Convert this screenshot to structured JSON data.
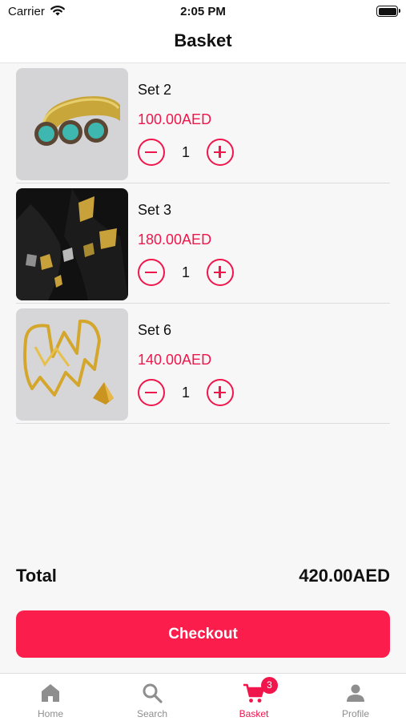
{
  "status_bar": {
    "carrier": "Carrier",
    "time": "2:05 PM"
  },
  "header": {
    "title": "Basket"
  },
  "items": [
    {
      "name": "Set 2",
      "price": "100.00AED",
      "quantity": "1",
      "image": "turquoise-ring-and-gold-cuff"
    },
    {
      "name": "Set 3",
      "price": "180.00AED",
      "quantity": "1",
      "image": "gold-geometric-necklace-on-black"
    },
    {
      "name": "Set 6",
      "price": "140.00AED",
      "quantity": "1",
      "image": "gold-wire-cuff-and-triangle-ring"
    }
  ],
  "summary": {
    "total_label": "Total",
    "total_value": "420.00AED"
  },
  "checkout": {
    "label": "Checkout"
  },
  "tabs": [
    {
      "label": "Home",
      "icon": "home-icon",
      "active": false
    },
    {
      "label": "Search",
      "icon": "search-icon",
      "active": false
    },
    {
      "label": "Basket",
      "icon": "cart-icon",
      "active": true,
      "badge": "3"
    },
    {
      "label": "Profile",
      "icon": "person-icon",
      "active": false
    }
  ],
  "colors": {
    "accent": "#f0164b",
    "checkout": "#fb1d4b",
    "inactive_tab": "#8e8e8e"
  }
}
